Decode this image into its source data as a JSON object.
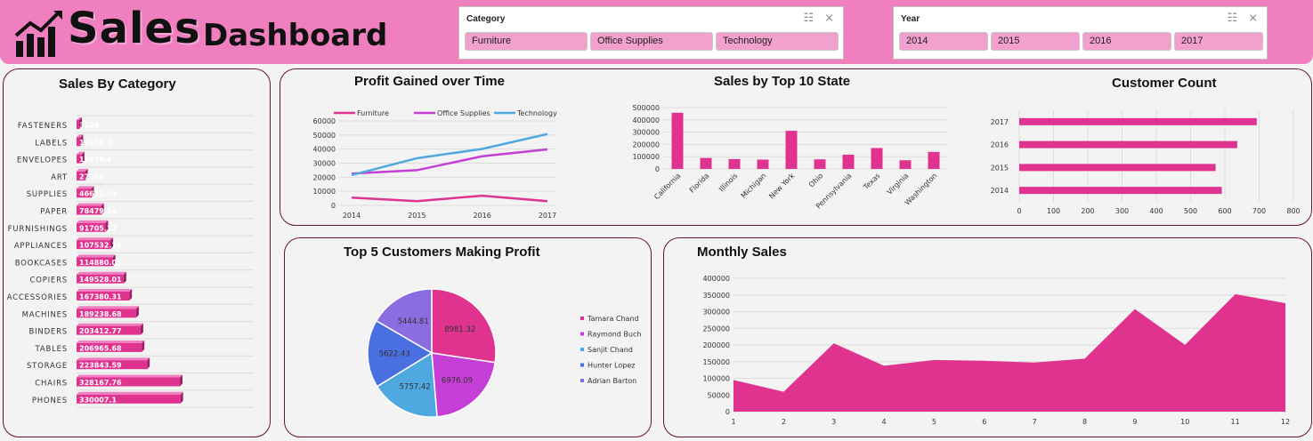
{
  "header": {
    "title_main": "Sales",
    "title_sub": "Dashboard",
    "logo_icon": "bar-chart-trend-icon"
  },
  "slicers": {
    "category": {
      "title": "Category",
      "items": [
        "Furniture",
        "Office Supplies",
        "Technology"
      ]
    },
    "year": {
      "title": "Year",
      "items": [
        "2014",
        "2015",
        "2016",
        "2017"
      ]
    },
    "icons": [
      "multi-select-icon",
      "clear-filter-icon"
    ]
  },
  "colors": {
    "primary": "#e0338f",
    "purple": "#c53fd6",
    "blue": "#4fa8e0",
    "header": "#f07fc0"
  },
  "chart_data": [
    {
      "type": "bar",
      "orientation": "horizontal",
      "title": "Sales By Category",
      "categories": [
        "FASTENERS",
        "LABELS",
        "ENVELOPES",
        "ART",
        "SUPPLIES",
        "PAPER",
        "FURNISHINGS",
        "APPLIANCES",
        "BOOKCASES",
        "COPIERS",
        "ACCESSORIES",
        "MACHINES",
        "BINDERS",
        "TABLES",
        "STORAGE",
        "CHAIRS",
        "PHONES"
      ],
      "values": [
        3024.28,
        12486.3,
        16476.4,
        27118.79,
        46673.54,
        78479.24,
        91705.12,
        107532.14,
        114880.05,
        149528.01,
        167380.31,
        189238.68,
        203412.77,
        206965.68,
        223843.59,
        328167.76,
        330007.1
      ],
      "labels": [
        "3024",
        "12486.3",
        "16476.4",
        "27118",
        "46673.54",
        "78479.24",
        "91705.12",
        "107532.14",
        "114880.05",
        "149528.01",
        "167380.31",
        "189238.68",
        "203412.77",
        "206965.68",
        "223843.59",
        "328167.76",
        "330007.1"
      ],
      "xlim": [
        0,
        560000
      ]
    },
    {
      "type": "line",
      "title": "Profit Gained over Time",
      "x": [
        "2014",
        "2015",
        "2016",
        "2017"
      ],
      "series": [
        {
          "name": "Furniture",
          "values": [
            5500,
            3000,
            6900,
            3000
          ]
        },
        {
          "name": "Office Supplies",
          "values": [
            22600,
            25000,
            34900,
            39800
          ]
        },
        {
          "name": "Technology",
          "values": [
            21500,
            33500,
            40100,
            50700
          ]
        }
      ],
      "ylim": [
        0,
        60000
      ],
      "yticks": [
        "0",
        "10000",
        "20000",
        "30000",
        "40000",
        "50000",
        "60000"
      ],
      "legend": "top"
    },
    {
      "type": "bar",
      "title": "Sales by Top 10 State",
      "categories": [
        "California",
        "Florida",
        "Illinois",
        "Michigan",
        "New York",
        "Ohio",
        "Pennsylvania",
        "Texas",
        "Virginia",
        "Washington"
      ],
      "values": [
        457688,
        89474,
        80166,
        76270,
        310876,
        78258,
        116512,
        170188,
        70637,
        138641
      ],
      "ylim": [
        0,
        500000
      ],
      "yticks": [
        "0",
        "100000",
        "200000",
        "300000",
        "400000",
        "500000"
      ]
    },
    {
      "type": "bar",
      "orientation": "horizontal",
      "title": "Customer Count",
      "categories": [
        "2017",
        "2016",
        "2015",
        "2014"
      ],
      "values": [
        693,
        636,
        573,
        591
      ],
      "xlim": [
        0,
        800
      ],
      "xticks": [
        "0",
        "100",
        "200",
        "300",
        "400",
        "500",
        "600",
        "700",
        "800"
      ]
    },
    {
      "type": "pie",
      "title": "Top 5 Customers Making Profit",
      "labels": [
        "Tamara Chand",
        "Raymond Buch",
        "Sanjit Chand",
        "Hunter Lopez",
        "Adrian Barton"
      ],
      "values": [
        8981.32,
        6976.09,
        5757.42,
        5622.43,
        5444.81
      ],
      "value_labels": [
        "8981.32",
        "6976.09",
        "5757.42",
        "5622.43",
        "5444.81"
      ],
      "colors": [
        "#e0338f",
        "#c53fd6",
        "#4fa8e0",
        "#4a6fe0",
        "#8a6ee0"
      ],
      "legend": "right"
    },
    {
      "type": "area",
      "title": "Monthly Sales",
      "x": [
        "1",
        "2",
        "3",
        "4",
        "5",
        "6",
        "7",
        "8",
        "9",
        "10",
        "11",
        "12"
      ],
      "values": [
        94925,
        59751,
        205005,
        137762,
        155028,
        152718,
        147238,
        159044,
        307650,
        200323,
        352461,
        325293
      ],
      "ylim": [
        0,
        400000
      ],
      "yticks": [
        "0",
        "50000",
        "100000",
        "150000",
        "200000",
        "250000",
        "300000",
        "350000",
        "400000"
      ]
    }
  ]
}
